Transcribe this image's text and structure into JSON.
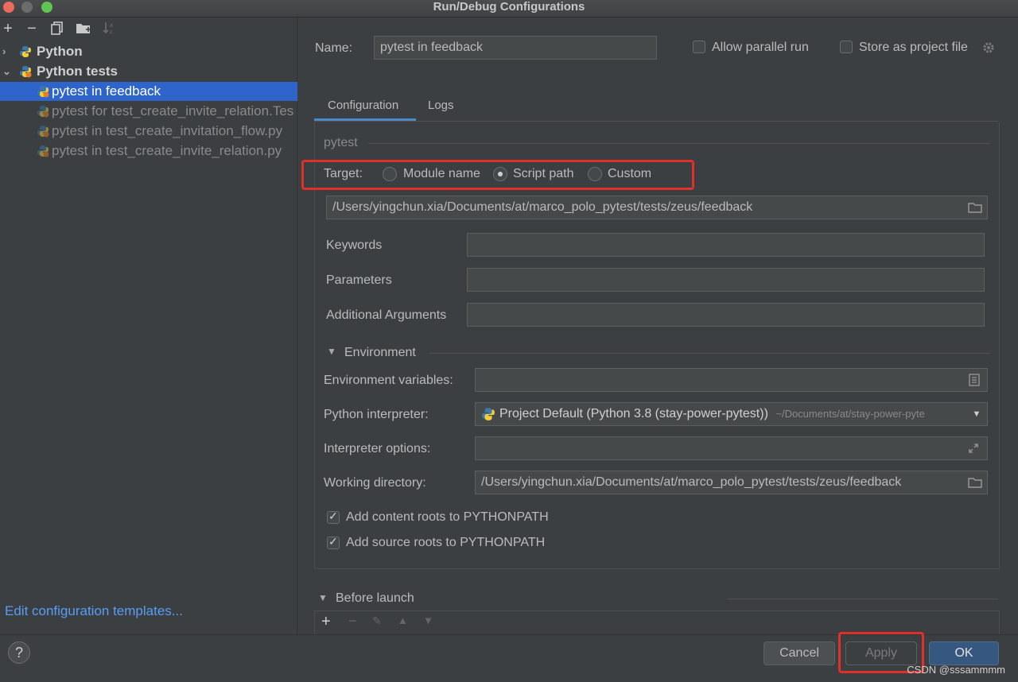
{
  "window": {
    "title": "Run/Debug Configurations"
  },
  "toolbar": {
    "add": "+",
    "remove": "−",
    "copy_icon": "copy-icon",
    "folder_icon": "new-folder-icon",
    "sort_icon": "sort-icon"
  },
  "tree": {
    "groups": [
      {
        "label": "Python",
        "expanded": false
      },
      {
        "label": "Python tests",
        "expanded": true
      }
    ],
    "children": [
      "pytest in feedback",
      "pytest for test_create_invite_relation.Tes",
      "pytest in test_create_invitation_flow.py",
      "pytest in test_create_invite_relation.py"
    ],
    "selected_index": 0
  },
  "left_footer": {
    "edit_templates": "Edit configuration templates..."
  },
  "header": {
    "name_label": "Name:",
    "name_value": "pytest in feedback",
    "allow_parallel": "Allow parallel run",
    "store_project_file": "Store as project file"
  },
  "tabs": [
    "Configuration",
    "Logs"
  ],
  "config": {
    "section_pytest": "pytest",
    "target_label": "Target:",
    "target_options": [
      "Module name",
      "Script path",
      "Custom"
    ],
    "target_selected": "Script path",
    "script_path": "/Users/yingchun.xia/Documents/at/marco_polo_pytest/tests/zeus/feedback",
    "keywords_label": "Keywords",
    "parameters_label": "Parameters",
    "additional_args_label": "Additional Arguments",
    "environment_section": "Environment",
    "env_vars_label": "Environment variables:",
    "interpreter_label": "Python interpreter:",
    "interpreter_value": "Project Default (Python 3.8 (stay-power-pytest))",
    "interpreter_path": "~/Documents/at/stay-power-pyte",
    "interpreter_options_label": "Interpreter options:",
    "working_dir_label": "Working directory:",
    "working_dir_value": "/Users/yingchun.xia/Documents/at/marco_polo_pytest/tests/zeus/feedback",
    "add_content_roots": "Add content roots to PYTHONPATH",
    "add_source_roots": "Add source roots to PYTHONPATH",
    "before_launch": "Before launch"
  },
  "buttons": {
    "help": "?",
    "cancel": "Cancel",
    "apply": "Apply",
    "ok": "OK"
  },
  "watermark": "CSDN @sssammmm",
  "colors": {
    "selection": "#2f65ca",
    "link": "#589df6",
    "highlight_box": "#e0302a",
    "ok_button": "#365880"
  }
}
